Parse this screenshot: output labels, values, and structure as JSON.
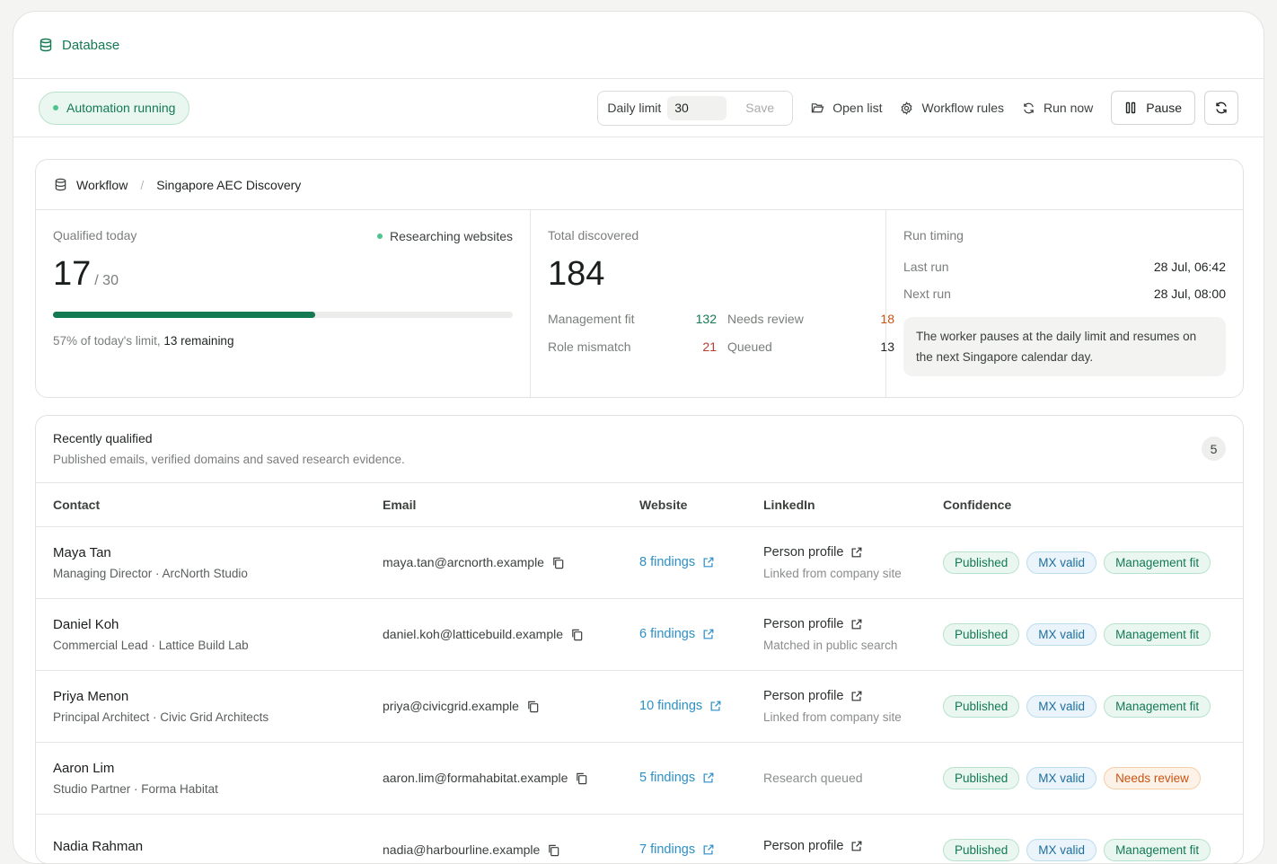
{
  "header": {
    "title": "Database"
  },
  "toolbar": {
    "status": "Automation running",
    "daily_limit_label": "Daily limit",
    "daily_limit_value": "30",
    "save_label": "Save",
    "open_list": "Open list",
    "workflow_rules": "Workflow rules",
    "run_now": "Run now",
    "pause": "Pause"
  },
  "workflow": {
    "breadcrumb_root": "Workflow",
    "breadcrumb_current": "Singapore AEC Discovery",
    "qualified": {
      "label": "Qualified today",
      "status": "Researching websites",
      "value": "17",
      "limit": "/ 30",
      "progress": 0.57,
      "summary_prefix": "57% of today's limit,",
      "summary_remaining": "13 remaining"
    },
    "discovered": {
      "label": "Total discovered",
      "value": "184",
      "management_fit_label": "Management fit",
      "management_fit": "132",
      "needs_review_label": "Needs review",
      "needs_review": "18",
      "role_mismatch_label": "Role mismatch",
      "role_mismatch": "21",
      "queued_label": "Queued",
      "queued": "13"
    },
    "timing": {
      "label": "Run timing",
      "last_run_label": "Last run",
      "last_run": "28 Jul, 06:42",
      "next_run_label": "Next run",
      "next_run": "28 Jul, 08:00",
      "note": "The worker pauses at the daily limit and resumes on the next Singapore calendar day."
    }
  },
  "recent": {
    "title": "Recently qualified",
    "subtitle": "Published emails, verified domains and saved research evidence.",
    "count": "5",
    "columns": [
      "Contact",
      "Email",
      "Website",
      "LinkedIn",
      "Confidence"
    ],
    "rows": [
      {
        "name": "Maya Tan",
        "role": "Managing Director · ArcNorth Studio",
        "email": "maya.tan@arcnorth.example",
        "website": "8 findings",
        "linkedin": "Person profile",
        "linkedin_sub": "Linked from company site",
        "badges": [
          "Published",
          "MX valid",
          "Management fit"
        ]
      },
      {
        "name": "Daniel Koh",
        "role": "Commercial Lead · Lattice Build Lab",
        "email": "daniel.koh@latticebuild.example",
        "website": "6 findings",
        "linkedin": "Person profile",
        "linkedin_sub": "Matched in public search",
        "badges": [
          "Published",
          "MX valid",
          "Management fit"
        ]
      },
      {
        "name": "Priya Menon",
        "role": "Principal Architect · Civic Grid Architects",
        "email": "priya@civicgrid.example",
        "website": "10 findings",
        "linkedin": "Person profile",
        "linkedin_sub": "Linked from company site",
        "badges": [
          "Published",
          "MX valid",
          "Management fit"
        ]
      },
      {
        "name": "Aaron Lim",
        "role": "Studio Partner · Forma Habitat",
        "email": "aaron.lim@formahabitat.example",
        "website": "5 findings",
        "linkedin_muted": "Research queued",
        "badges": [
          "Published",
          "MX valid",
          "Needs review"
        ]
      },
      {
        "name": "Nadia Rahman",
        "role": "",
        "email": "nadia@harbourline.example",
        "website": "7 findings",
        "linkedin": "Person profile",
        "linkedin_sub": "",
        "badges": [
          "Published",
          "MX valid",
          "Management fit"
        ]
      }
    ]
  }
}
